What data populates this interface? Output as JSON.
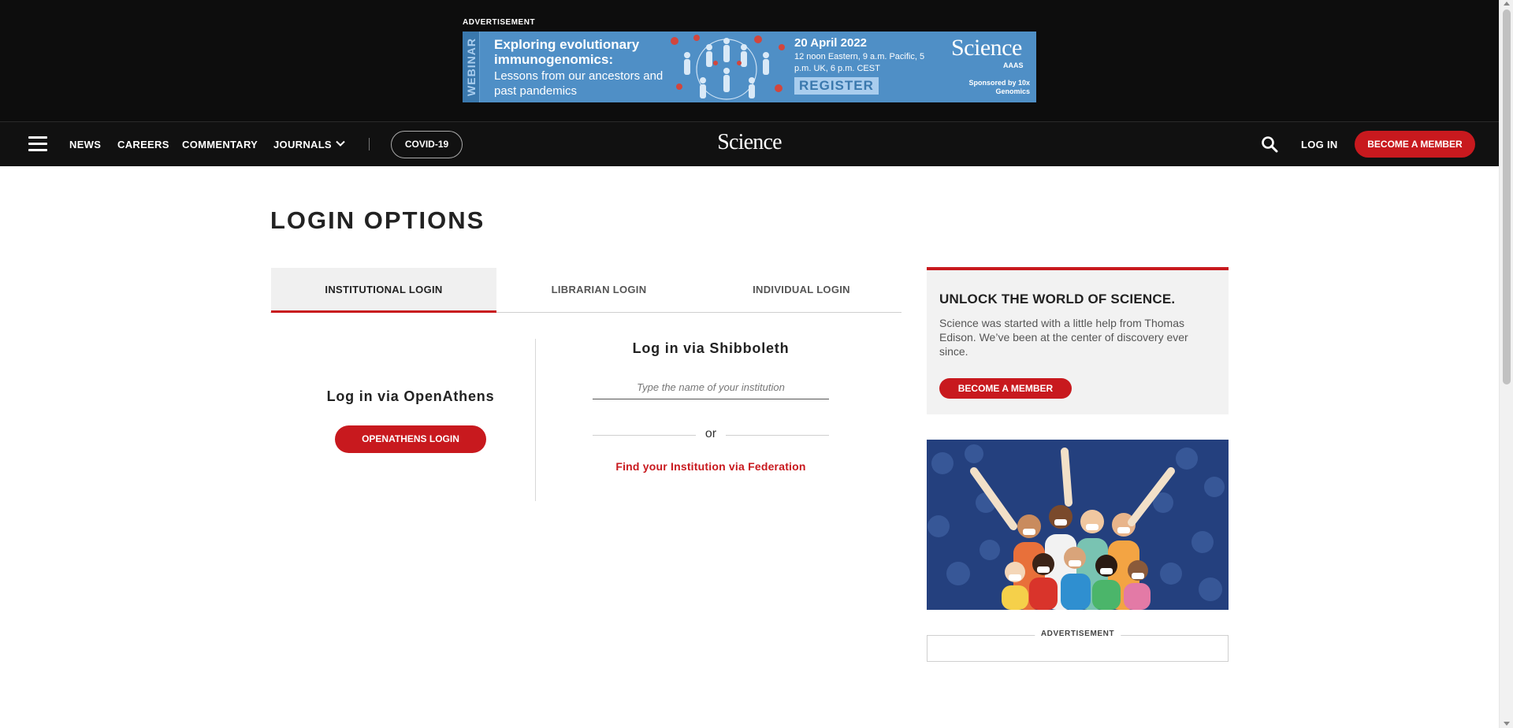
{
  "ad": {
    "label": "ADVERTISEMENT",
    "vertical_tag": "WEBINAR",
    "headline": "Exploring evolutionary immunogenomics:",
    "subheadline": "Lessons from our ancestors and past pandemics",
    "date": "20 April 2022",
    "time": "12 noon Eastern, 9 a.m. Pacific, 5 p.m. UK, 6 p.m. CEST",
    "register_label": "REGISTER",
    "brand": "Science",
    "brand_sub": "AAAS",
    "sponsor": "Sponsored by 10x Genomics"
  },
  "nav": {
    "menu_icon": "hamburger-icon",
    "links": [
      "NEWS",
      "CAREERS",
      "COMMENTARY",
      "JOURNALS"
    ],
    "covid": "COVID-19",
    "logo": "Science",
    "search_icon": "search-icon",
    "login": "LOG IN",
    "member": "BECOME A MEMBER"
  },
  "main": {
    "title": "LOGIN OPTIONS",
    "tabs": [
      {
        "label": "INSTITUTIONAL LOGIN",
        "active": true
      },
      {
        "label": "LIBRARIAN LOGIN",
        "active": false
      },
      {
        "label": "INDIVIDUAL LOGIN",
        "active": false
      }
    ],
    "openathens": {
      "heading": "Log in via OpenAthens",
      "button": "OPENATHENS LOGIN"
    },
    "shibboleth": {
      "heading": "Log in via Shibboleth",
      "placeholder": "Type the name of your institution",
      "value": "",
      "or": "or",
      "federation_link": "Find your Institution via Federation"
    }
  },
  "sidebar": {
    "promo_title": "UNLOCK THE WORLD OF SCIENCE.",
    "promo_text": "Science was started with a little help from Thomas Edison. We’ve been at the center of discovery ever since.",
    "promo_button": "BECOME A MEMBER",
    "ad_label": "ADVERTISEMENT"
  },
  "colors": {
    "accent": "#c8191e",
    "nav_bg": "#111111",
    "ad_blue": "#4f8fc6"
  }
}
